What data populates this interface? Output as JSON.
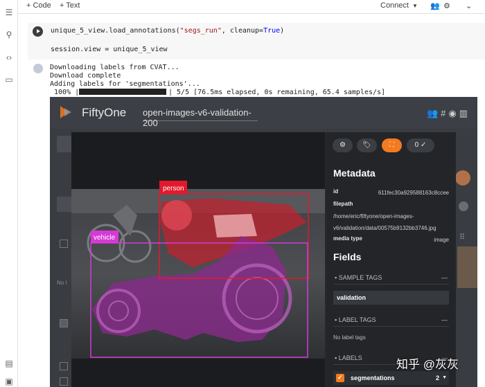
{
  "colab": {
    "add_code": "+ Code",
    "add_text": "+ Text",
    "connect": "Connect"
  },
  "cell": {
    "line1_pre": "unique_5_view.load_annotations(",
    "line1_str": "\"segs_run\"",
    "line1_mid": ", cleanup=",
    "line1_kw": "True",
    "line1_post": ")",
    "line2": "session.view = unique_5_view"
  },
  "output": {
    "line1": "Downloading labels from CVAT...",
    "line2": "Download complete",
    "line3": "Adding labels for 'segmentations'...",
    "progress_pct": " 100% |",
    "progress_tail": "| 5/5 [76.5ms elapsed, 0s remaining, 65.4 samples/s]",
    "progress_fraction": 1.0
  },
  "fiftyone": {
    "title": "FiftyOne",
    "dataset": "open-images-v6-validation-200"
  },
  "viewer": {
    "labels": [
      {
        "name": "person",
        "color": "#e3192b"
      },
      {
        "name": "vehicle",
        "color": "#d63ad6"
      }
    ]
  },
  "panel": {
    "tool_toggle": "0",
    "metadata_heading": "Metadata",
    "id_key": "id",
    "id_value": "611fec30a929588163c8ccee",
    "filepath_key": "filepath",
    "filepath_line1": "/home/eric/fiftyone/open-images-",
    "filepath_line2": "v6/validation/data/00575b9132bb3746.jpg",
    "media_type_key": "media type",
    "media_type_value": "image",
    "fields_heading": "Fields",
    "sample_tags": "SAMPLE TAGS",
    "tag_value": "validation",
    "label_tags": "LABEL TAGS",
    "no_label_tags": "No label tags",
    "labels": "LABELS",
    "segmentations": "segmentations",
    "segmentations_count": "2"
  },
  "watermark": "知乎 @灰灰",
  "colors": {
    "accent": "#f47a1f",
    "person": "#e3192b",
    "vehicle": "#d63ad6"
  }
}
